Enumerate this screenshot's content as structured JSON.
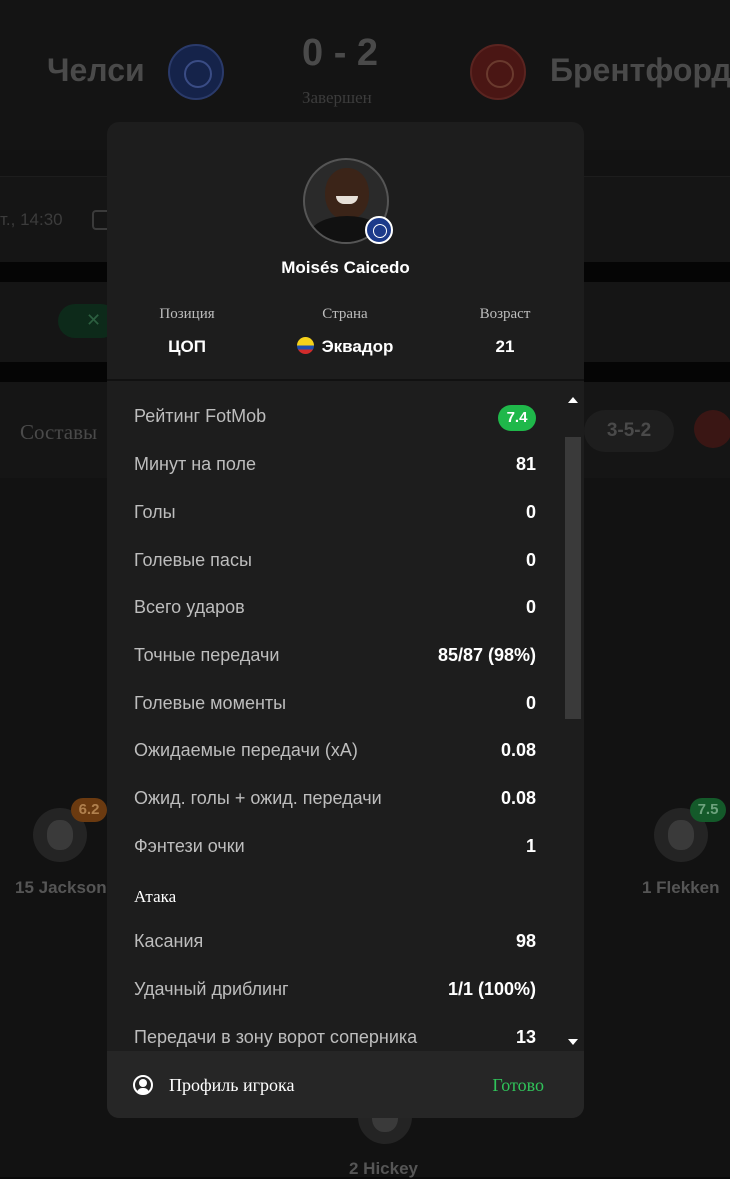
{
  "match": {
    "home_team": "Челси",
    "away_team": "Брентфорд",
    "score": "0 - 2",
    "status": "Завершен",
    "time": "т., 14:30",
    "tab_lineups": "Составы",
    "formation": "3-5-2"
  },
  "background_players": [
    {
      "number_name": "15 Jackson",
      "rating": "6.2",
      "rating_color": "#6b3a10"
    },
    {
      "number_name": "1 Flekken",
      "rating": "7.5",
      "rating_color": "#145a2a"
    },
    {
      "number_name": "2 Hickey"
    }
  ],
  "modal": {
    "player_name": "Moisés Caicedo",
    "info": [
      {
        "label": "Позиция",
        "value": "ЦОП"
      },
      {
        "label": "Страна",
        "value": "Эквадор",
        "icon": "ecuador-flag-icon"
      },
      {
        "label": "Возраст",
        "value": "21"
      }
    ],
    "stats": [
      {
        "label": "Рейтинг FotMob",
        "value": "7.4",
        "badge": true,
        "badge_color": "#1fb84a"
      },
      {
        "label": "Минут на поле",
        "value": "81"
      },
      {
        "label": "Голы",
        "value": "0"
      },
      {
        "label": "Голевые пасы",
        "value": "0"
      },
      {
        "label": "Всего ударов",
        "value": "0"
      },
      {
        "label": "Точные передачи",
        "value": "85/87 (98%)"
      },
      {
        "label": "Голевые моменты",
        "value": "0"
      },
      {
        "label": "Ожидаемые передачи (xA)",
        "value": "0.08"
      },
      {
        "label": "Ожид. голы + ожид. передачи",
        "value": "0.08"
      },
      {
        "label": "Фэнтези очки",
        "value": "1"
      }
    ],
    "section_attack": "Атака",
    "attack_stats": [
      {
        "label": "Касания",
        "value": "98"
      },
      {
        "label": "Удачный дриблинг",
        "value": "1/1 (100%)"
      },
      {
        "label": "Передачи в зону ворот соперника",
        "value": "13"
      }
    ],
    "footer": {
      "profile_label": "Профиль игрока",
      "done_label": "Готово",
      "accent": "#30c35a"
    }
  }
}
